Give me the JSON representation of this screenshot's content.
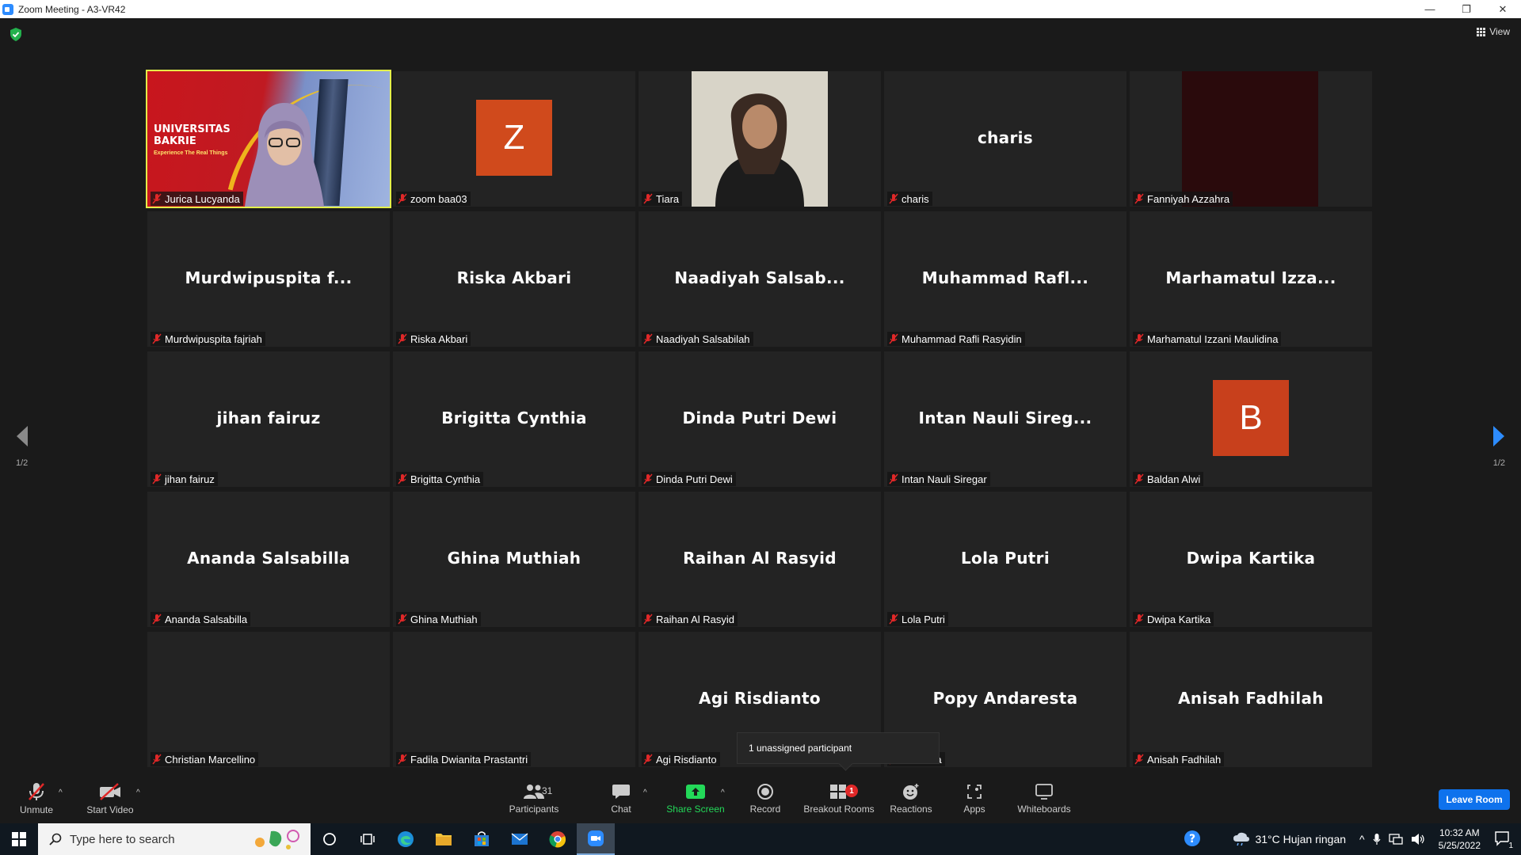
{
  "window": {
    "title": "Zoom Meeting - A3-VR42",
    "minimize": "—",
    "restore": "❐",
    "close": "✕"
  },
  "view_label": "View",
  "pagination": {
    "left": "1/2",
    "right": "1/2"
  },
  "tiles": [
    {
      "name": "Jurica Lucyanda",
      "big": "",
      "type": "video",
      "video_text": {
        "line1": "UNIVERSITAS",
        "line2": "BAKRIE",
        "tagline": "Experience The Real Things"
      }
    },
    {
      "name": "zoom baa03",
      "big": "",
      "type": "avatar",
      "letter": "Z",
      "color": "#d04a1c"
    },
    {
      "name": "Tiara",
      "big": "",
      "type": "photo"
    },
    {
      "name": "charis",
      "big": "charis",
      "type": "name"
    },
    {
      "name": "Fanniyah Azzahra",
      "big": "",
      "type": "dark"
    },
    {
      "name": "Murdwipuspita fajriah",
      "big": "Murdwipuspita  f...",
      "type": "name"
    },
    {
      "name": "Riska Akbari",
      "big": "Riska Akbari",
      "type": "name"
    },
    {
      "name": "Naadiyah Salsabilah",
      "big": "Naadiyah  Salsab...",
      "type": "name"
    },
    {
      "name": "Muhammad Rafli Rasyidin",
      "big": "Muhammad  Rafl...",
      "type": "name"
    },
    {
      "name": "Marhamatul Izzani Maulidina",
      "big": "Marhamatul  Izza...",
      "type": "name"
    },
    {
      "name": "jihan fairuz",
      "big": "jihan fairuz",
      "type": "name"
    },
    {
      "name": "Brigitta Cynthia",
      "big": "Brigitta Cynthia",
      "type": "name"
    },
    {
      "name": "Dinda Putri Dewi",
      "big": "Dinda Putri Dewi",
      "type": "name"
    },
    {
      "name": "Intan Nauli Siregar",
      "big": "Intan  Nauli  Sireg...",
      "type": "name"
    },
    {
      "name": "Baldan Alwi",
      "big": "",
      "type": "avatar",
      "letter": "B",
      "color": "#c8401c"
    },
    {
      "name": "Ananda Salsabilla",
      "big": "Ananda Salsabilla",
      "type": "name"
    },
    {
      "name": "Ghina Muthiah",
      "big": "Ghina Muthiah",
      "type": "name"
    },
    {
      "name": "Raihan Al Rasyid",
      "big": "Raihan Al Rasyid",
      "type": "name"
    },
    {
      "name": "Lola Putri",
      "big": "Lola Putri",
      "type": "name"
    },
    {
      "name": "Dwipa Kartika",
      "big": "Dwipa Kartika",
      "type": "name"
    },
    {
      "name": "Christian Marcellino",
      "big": "",
      "type": "name"
    },
    {
      "name": "Fadila Dwianita Prastantri",
      "big": "",
      "type": "name"
    },
    {
      "name": "Agi Risdianto",
      "big": "Agi Risdianto",
      "type": "name"
    },
    {
      "name": "ndaresta",
      "big": "Popy Andaresta",
      "type": "name"
    },
    {
      "name": "Anisah Fadhilah",
      "big": "Anisah Fadhilah",
      "type": "name"
    }
  ],
  "tooltip": "1 unassigned participant",
  "toolbar": {
    "unmute": "Unmute",
    "start_video": "Start Video",
    "participants": "Participants",
    "participants_count": "31",
    "chat": "Chat",
    "share_screen": "Share Screen",
    "record": "Record",
    "breakout_rooms": "Breakout Rooms",
    "breakout_badge": "1",
    "reactions": "Reactions",
    "apps": "Apps",
    "whiteboards": "Whiteboards",
    "leave": "Leave Room"
  },
  "taskbar": {
    "search_placeholder": "Type here to search",
    "weather": "31°C  Hujan ringan",
    "time": "10:32 AM",
    "date": "5/25/2022",
    "notification_count": "1"
  },
  "colors": {
    "active_speaker": "#e4f04a",
    "share_green": "#23d959",
    "leave_blue": "#0e72ed",
    "mute_red": "#e02828"
  }
}
